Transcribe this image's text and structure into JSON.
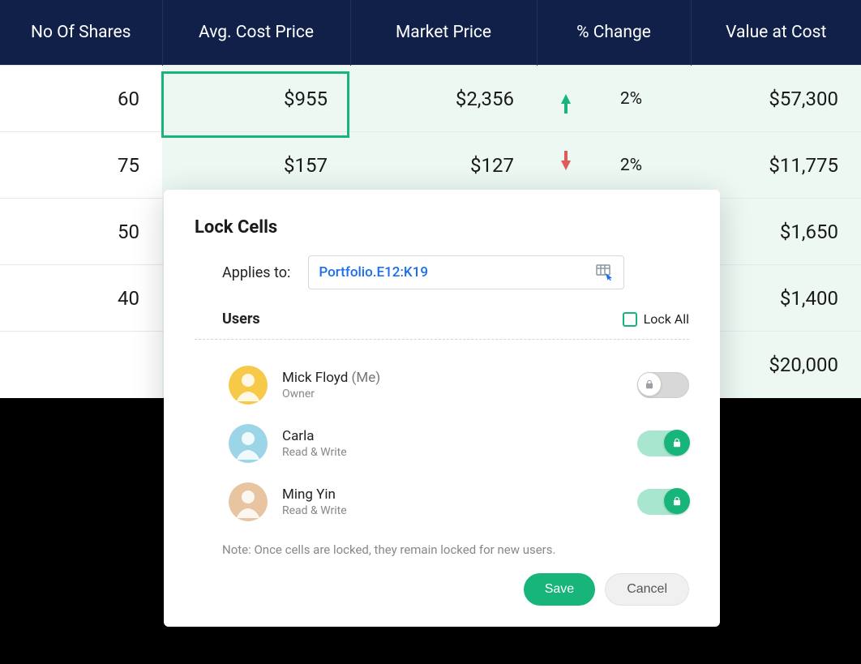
{
  "table": {
    "headers": [
      "No Of Shares",
      "Avg. Cost Price",
      "Market Price",
      "% Change",
      "Value at Cost"
    ],
    "rows": [
      {
        "shares": "60",
        "avg": "$955",
        "market": "$2,356",
        "direction": "up",
        "change": "2%",
        "value": "$57,300"
      },
      {
        "shares": "75",
        "avg": "$157",
        "market": "$127",
        "direction": "down",
        "change": "2%",
        "value": "$11,775"
      },
      {
        "shares": "50",
        "avg": "",
        "market": "",
        "direction": "",
        "change": "",
        "value": "$1,650"
      },
      {
        "shares": "40",
        "avg": "",
        "market": "",
        "direction": "",
        "change": "",
        "value": "$1,400"
      },
      {
        "shares": "",
        "avg": "",
        "market": "",
        "direction": "",
        "change": "",
        "value": "$20,000"
      }
    ]
  },
  "dialog": {
    "title": "Lock Cells",
    "applies_label": "Applies to:",
    "range": "Portfolio.E12:K19",
    "users_label": "Users",
    "lock_all_label": "Lock All",
    "users": [
      {
        "name": "Mick Floyd",
        "me": "(Me)",
        "role": "Owner",
        "locked": false,
        "avatar_bg": "#f7c948"
      },
      {
        "name": "Carla",
        "me": "",
        "role": "Read & Write",
        "locked": true,
        "avatar_bg": "#9cd4e8"
      },
      {
        "name": "Ming Yin",
        "me": "",
        "role": "Read & Write",
        "locked": true,
        "avatar_bg": "#e8c4a0"
      }
    ],
    "note": "Note: Once cells are locked, they remain locked for new users.",
    "save": "Save",
    "cancel": "Cancel"
  }
}
